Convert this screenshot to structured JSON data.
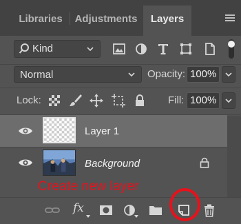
{
  "tabs": [
    {
      "label": "Libraries",
      "active": false
    },
    {
      "label": "Adjustments",
      "active": false
    },
    {
      "label": "Layers",
      "active": true
    }
  ],
  "filter": {
    "kind_label": "Kind",
    "icons": [
      "pixel-filter-icon",
      "adjustment-filter-icon",
      "type-filter-icon",
      "shape-filter-icon",
      "smart-object-filter-icon"
    ]
  },
  "blend": {
    "mode": "Normal",
    "opacity_label": "Opacity:",
    "opacity_value": "100%"
  },
  "lock": {
    "label": "Lock:",
    "fill_label": "Fill:",
    "fill_value": "100%"
  },
  "layers": [
    {
      "name": "Layer 1",
      "selected": true,
      "visible": true
    },
    {
      "name": "Background",
      "selected": false,
      "visible": true,
      "locked": true
    }
  ],
  "annotation": {
    "text": "Create new layer",
    "color": "#e6121c"
  },
  "footer": {
    "fx_label": "fx"
  },
  "colors": {
    "panel": "#535353",
    "tabbar": "#424242",
    "selected_row": "#6d6d6d",
    "annotation": "#e6121c"
  }
}
